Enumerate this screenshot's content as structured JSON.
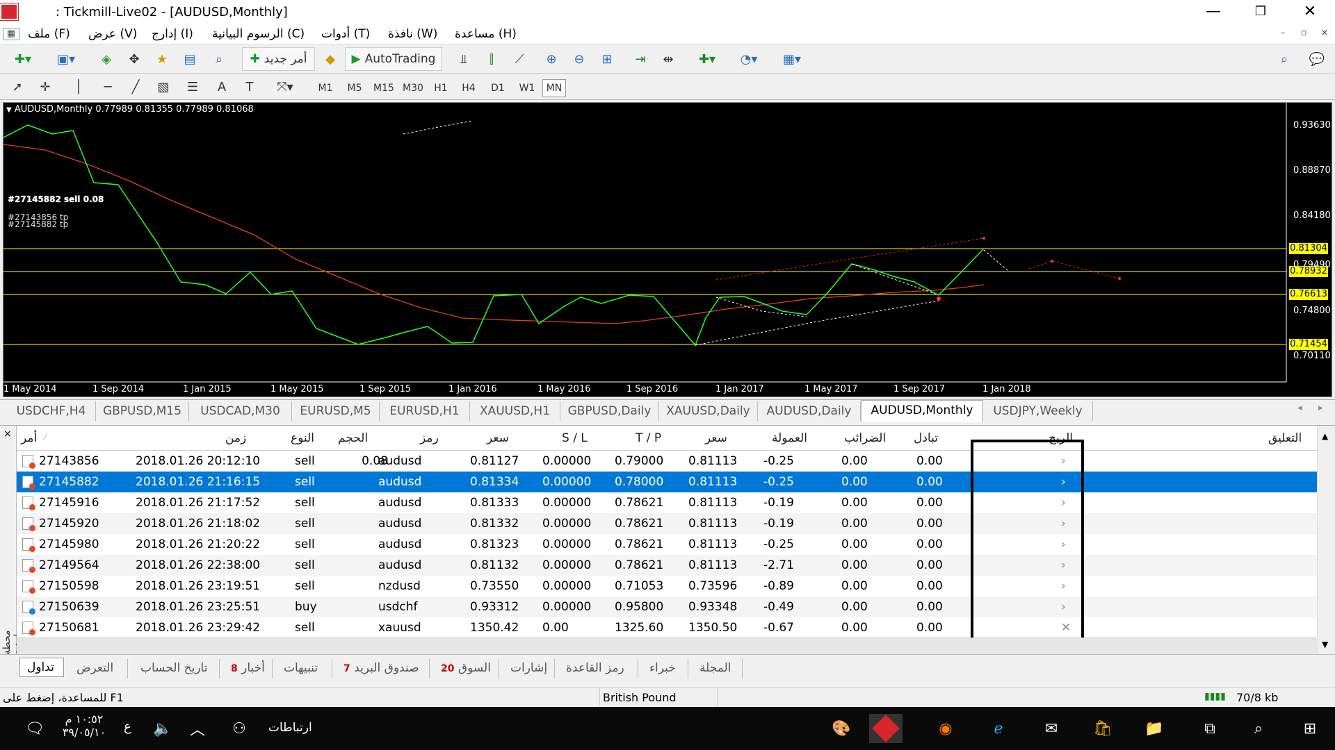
{
  "window": {
    "title": ": Tickmill-Live02 - [AUDUSD,Monthly]",
    "minimize": "—",
    "restore": "❐",
    "close": "✕"
  },
  "menu": {
    "items": [
      {
        "label": "ملف (F)"
      },
      {
        "label": "عرض (V)"
      },
      {
        "label": "إدارج (I)"
      },
      {
        "label": "الرسوم البيانية (C)"
      },
      {
        "label": "أدوات (T)"
      },
      {
        "label": "نافذة (W)"
      },
      {
        "label": "مساعدة (H)"
      }
    ]
  },
  "toolbar": {
    "new_order": "أمر جديد",
    "autotrading": "AutoTrading"
  },
  "timeframes": [
    "M1",
    "M5",
    "M15",
    "M30",
    "H1",
    "H4",
    "D1",
    "W1",
    "MN"
  ],
  "chart": {
    "header": "AUDUSD,Monthly  0.77989 0.81355 0.77989 0.81068",
    "order_label_sell": "#27145882 sell 0.08",
    "order_label_tp1": "#27143856 tp",
    "order_label_tp2": "#27145882 tp",
    "price_ticks": [
      "0.93630",
      "0.88870",
      "0.84180",
      "0.79490",
      "0.74800",
      "0.70110"
    ],
    "price_flags": [
      "0.81304",
      "0.78932",
      "0.76613",
      "0.71454"
    ],
    "date_ticks": [
      "1 May 2014",
      "1 Sep 2014",
      "1 Jan 2015",
      "1 May 2015",
      "1 Sep 2015",
      "1 Jan 2016",
      "1 May 2016",
      "1 Sep 2016",
      "1 Jan 2017",
      "1 May 2017",
      "1 Sep 2017",
      "1 Jan 2018"
    ],
    "flag_colors": {
      "yellow": "#ffff00",
      "line_green": "#22ff22",
      "ma_red": "#e2401e"
    }
  },
  "tabs": [
    "USDCHF,H4",
    "GBPUSD,M15",
    "USDCAD,M30",
    "EURUSD,M5",
    "EURUSD,H1",
    "XAUUSD,H1",
    "GBPUSD,Daily",
    "XAUUSD,Daily",
    "AUDUSD,Daily",
    "AUDUSD,Monthly",
    "USDJPY,Weekly"
  ],
  "terminal": {
    "headers": [
      "أمر",
      "زمن",
      "النوع",
      "الحجم",
      "رمز",
      "سعر",
      "S / L",
      "T / P",
      "سعر",
      "العمولة",
      "الضرائب",
      "تبادل",
      "الربح",
      "التعليق"
    ],
    "rows": [
      {
        "order": "27143856",
        "time": "2018.01.26 20:12:10",
        "type": "sell",
        "volume": "0.08",
        "symbol": "audusd",
        "price": "0.81127",
        "sl": "0.00000",
        "tp": "0.79000",
        "cur": "0.81113",
        "commission": "-0.25",
        "taxes": "0.00",
        "swap": "0.00"
      },
      {
        "order": "27145882",
        "time": "2018.01.26 21:16:15",
        "type": "sell",
        "volume": "",
        "symbol": "audusd",
        "price": "0.81334",
        "sl": "0.00000",
        "tp": "0.78000",
        "cur": "0.81113",
        "commission": "-0.25",
        "taxes": "0.00",
        "swap": "0.00"
      },
      {
        "order": "27145916",
        "time": "2018.01.26 21:17:52",
        "type": "sell",
        "volume": "",
        "symbol": "audusd",
        "price": "0.81333",
        "sl": "0.00000",
        "tp": "0.78621",
        "cur": "0.81113",
        "commission": "-0.19",
        "taxes": "0.00",
        "swap": "0.00"
      },
      {
        "order": "27145920",
        "time": "2018.01.26 21:18:02",
        "type": "sell",
        "volume": "",
        "symbol": "audusd",
        "price": "0.81332",
        "sl": "0.00000",
        "tp": "0.78621",
        "cur": "0.81113",
        "commission": "-0.19",
        "taxes": "0.00",
        "swap": "0.00"
      },
      {
        "order": "27145980",
        "time": "2018.01.26 21:20:22",
        "type": "sell",
        "volume": "",
        "symbol": "audusd",
        "price": "0.81323",
        "sl": "0.00000",
        "tp": "0.78621",
        "cur": "0.81113",
        "commission": "-0.25",
        "taxes": "0.00",
        "swap": "0.00"
      },
      {
        "order": "27149564",
        "time": "2018.01.26 22:38:00",
        "type": "sell",
        "volume": "",
        "symbol": "audusd",
        "price": "0.81132",
        "sl": "0.00000",
        "tp": "0.78621",
        "cur": "0.81113",
        "commission": "-2.71",
        "taxes": "0.00",
        "swap": "0.00"
      },
      {
        "order": "27150598",
        "time": "2018.01.26 23:19:51",
        "type": "sell",
        "volume": "",
        "symbol": "nzdusd",
        "price": "0.73550",
        "sl": "0.00000",
        "tp": "0.71053",
        "cur": "0.73596",
        "commission": "-0.89",
        "taxes": "0.00",
        "swap": "0.00"
      },
      {
        "order": "27150639",
        "time": "2018.01.26 23:25:51",
        "type": "buy",
        "volume": "",
        "symbol": "usdchf",
        "price": "0.93312",
        "sl": "0.00000",
        "tp": "0.95800",
        "cur": "0.93348",
        "commission": "-0.49",
        "taxes": "0.00",
        "swap": "0.00"
      },
      {
        "order": "27150681",
        "time": "2018.01.26 23:29:42",
        "type": "sell",
        "volume": "",
        "symbol": "xauusd",
        "price": "1350.42",
        "sl": "0.00",
        "tp": "1325.60",
        "cur": "1350.50",
        "commission": "-0.67",
        "taxes": "0.00",
        "swap": "0.00"
      }
    ],
    "side_label": "محطة طرفية"
  },
  "bottom_tabs": [
    {
      "label": "تداول"
    },
    {
      "label": "التعرض"
    },
    {
      "label": "تاريخ الحساب"
    },
    {
      "label": "أخبار",
      "badge": "8"
    },
    {
      "label": "تنبيهات"
    },
    {
      "label": "صندوق البريد",
      "badge": "7"
    },
    {
      "label": "السوق",
      "badge": "20"
    },
    {
      "label": "إشارات"
    },
    {
      "label": "رمز القاعدة"
    },
    {
      "label": "خبراء"
    },
    {
      "label": "المجلة"
    }
  ],
  "status": {
    "help": "للمساعدة، إضغط على  F1",
    "symbol": "British Pound",
    "traffic": "70/8 kb"
  },
  "taskbar": {
    "time": "١٠:٥٢ م",
    "date": "٣٩/٠٥/١٠",
    "lang": "ع",
    "links": "ارتباطات"
  }
}
